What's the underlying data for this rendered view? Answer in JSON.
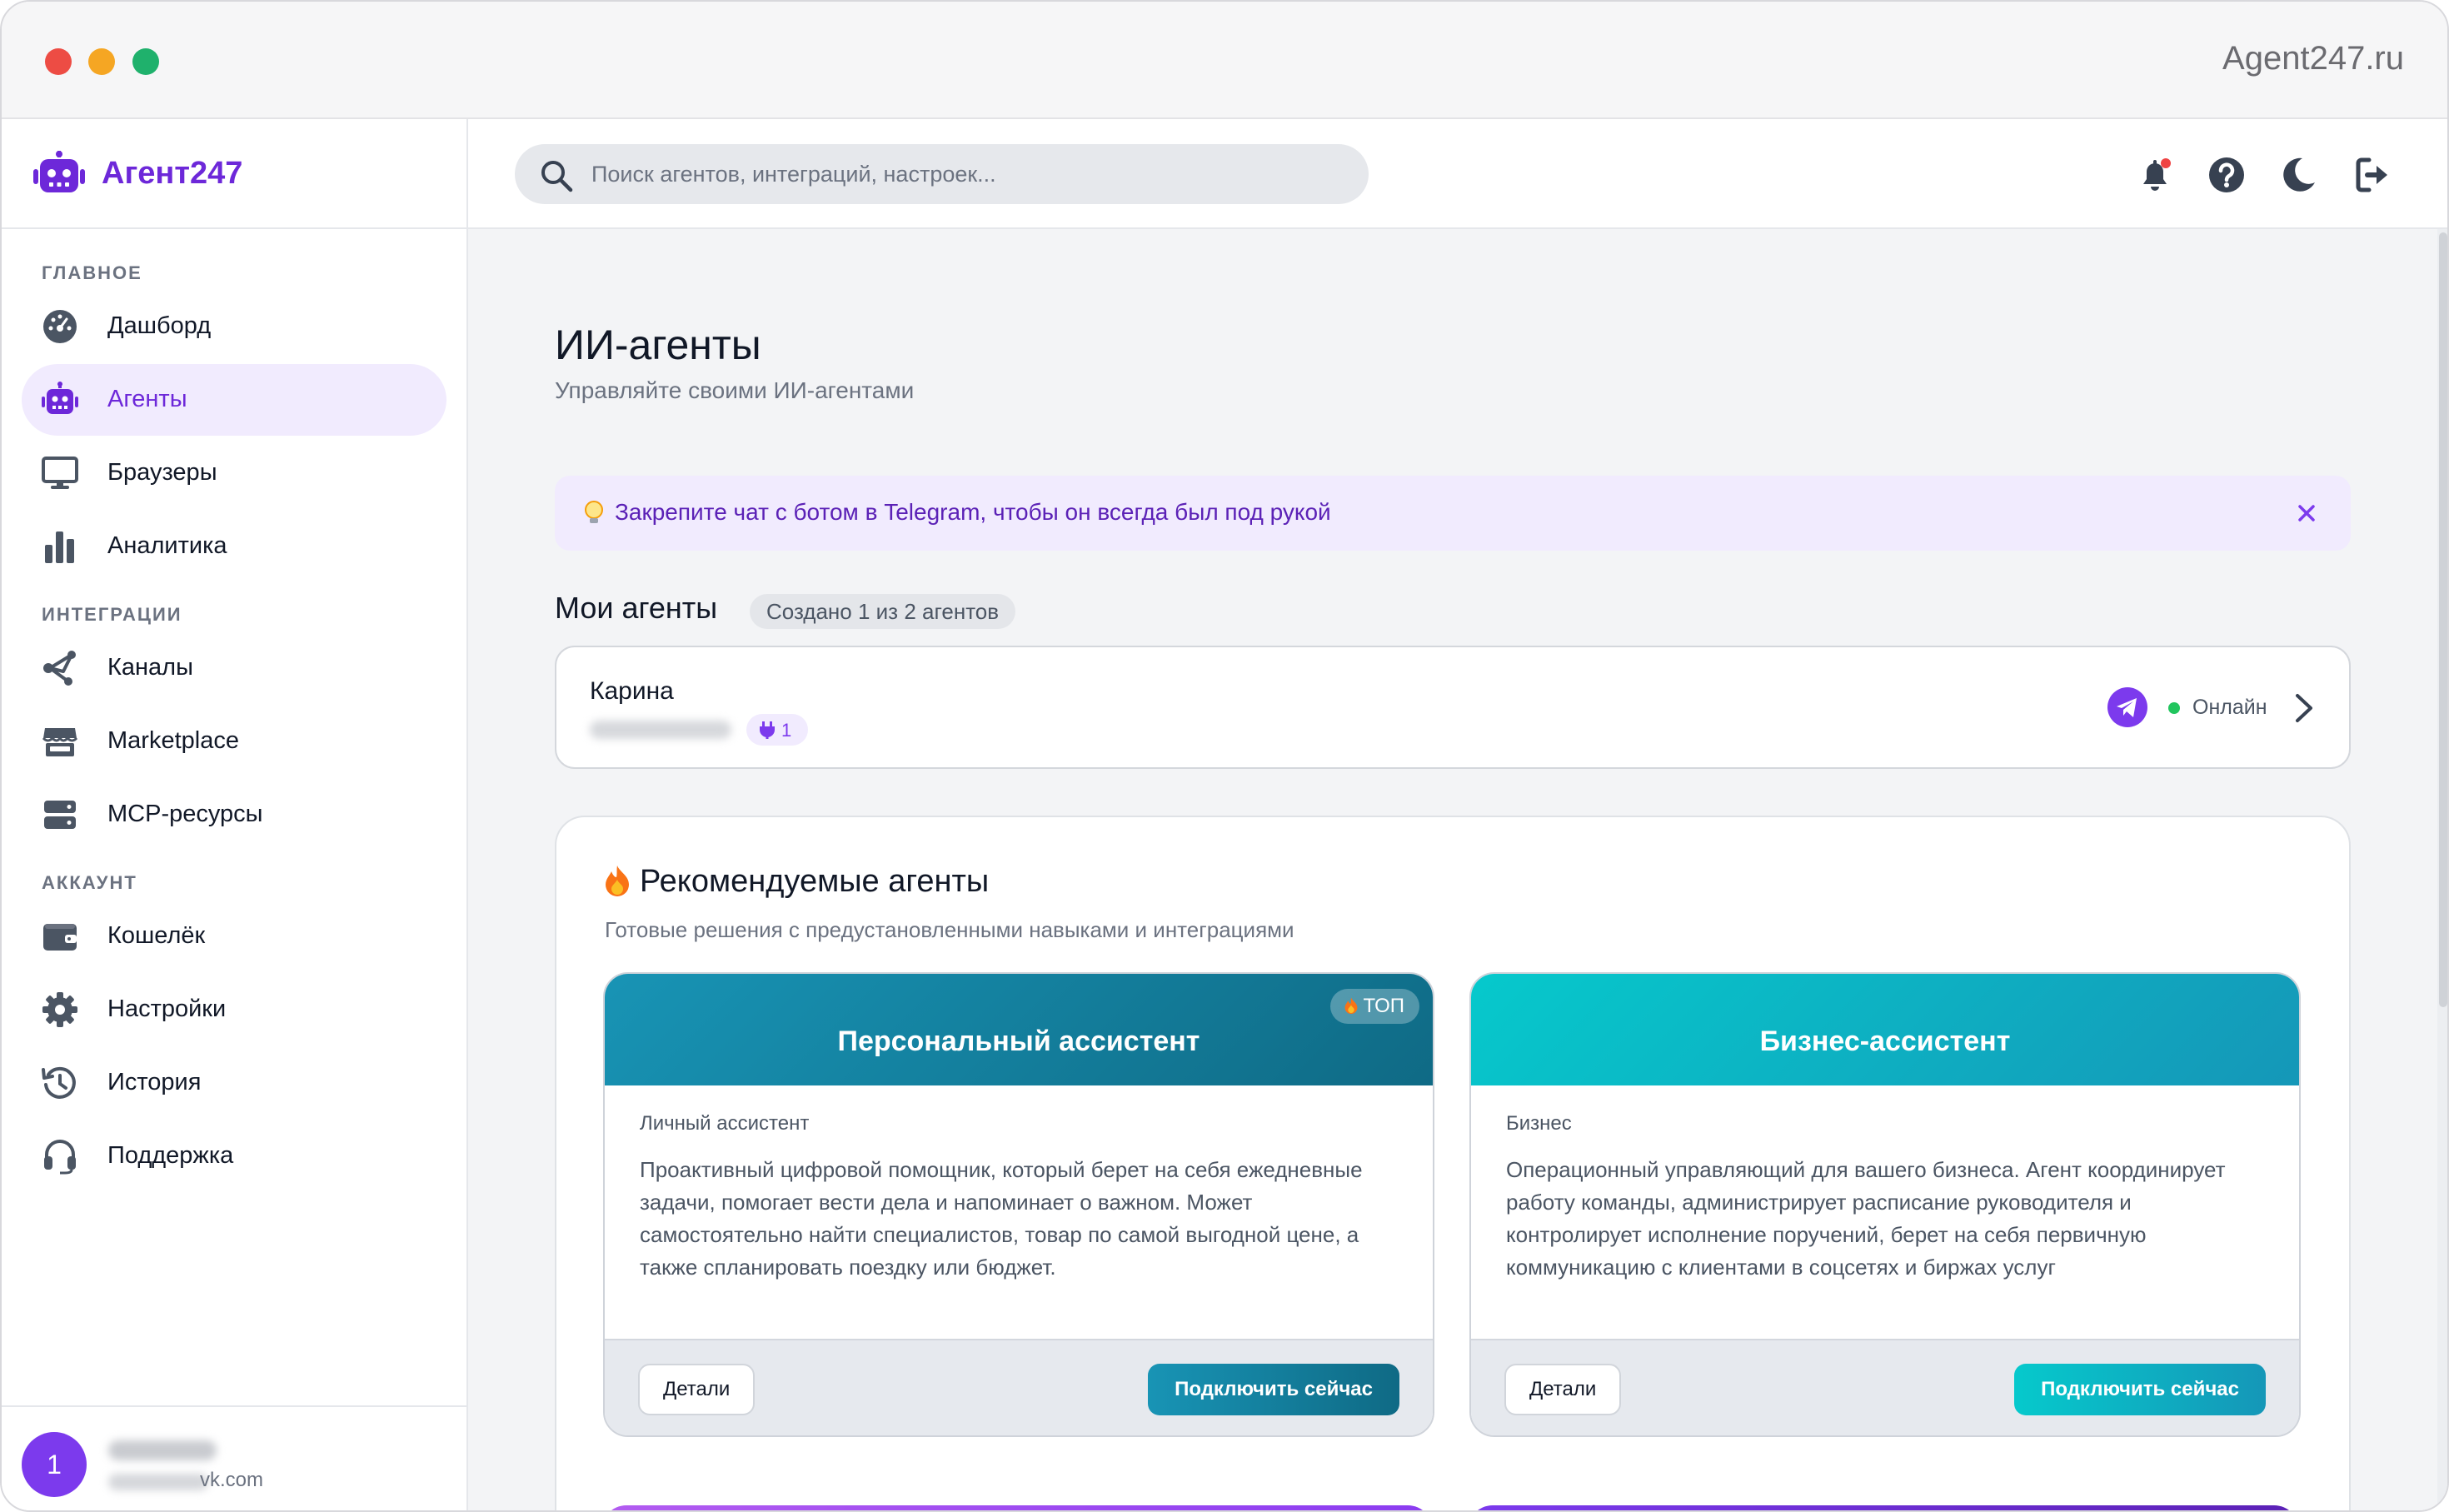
{
  "window": {
    "url": "Agent247.ru"
  },
  "brand": {
    "name": "Агент247"
  },
  "search": {
    "placeholder": "Поиск агентов, интеграций, настроек..."
  },
  "sidebar": {
    "sections": [
      {
        "title": "ГЛАВНОЕ",
        "items": [
          {
            "label": "Дашборд",
            "icon": "dashboard-gauge-icon"
          },
          {
            "label": "Агенты",
            "icon": "robot-icon",
            "active": true
          },
          {
            "label": "Браузеры",
            "icon": "monitor-icon"
          },
          {
            "label": "Аналитика",
            "icon": "bar-chart-icon"
          }
        ]
      },
      {
        "title": "ИНТЕГРАЦИИ",
        "items": [
          {
            "label": "Каналы",
            "icon": "share-nodes-icon"
          },
          {
            "label": "Marketplace",
            "icon": "store-icon"
          },
          {
            "label": "MCP-ресурсы",
            "icon": "server-icon"
          }
        ]
      },
      {
        "title": "АККАУНТ",
        "items": [
          {
            "label": "Кошелёк",
            "icon": "wallet-icon"
          },
          {
            "label": "Настройки",
            "icon": "gear-icon"
          },
          {
            "label": "История",
            "icon": "history-icon"
          },
          {
            "label": "Поддержка",
            "icon": "headset-icon"
          }
        ]
      }
    ]
  },
  "user": {
    "avatar_initial": "1",
    "email_suffix": "vk.com"
  },
  "header_icons": [
    "bell-icon",
    "help-icon",
    "moon-icon",
    "logout-icon"
  ],
  "page": {
    "title": "ИИ-агенты",
    "subtitle": "Управляйте своими ИИ-агентами"
  },
  "banner": {
    "text": "Закрепите чат с ботом в Telegram, чтобы он всегда был под рукой",
    "close": "×"
  },
  "my_agents": {
    "title": "Мои агенты",
    "count_label": "Создано 1 из 2 агентов",
    "items": [
      {
        "name": "Карина",
        "plugins": "1",
        "status": "Онлайн",
        "channel": "telegram"
      }
    ]
  },
  "recommended": {
    "title": "Рекомендуемые агенты",
    "subtitle": "Готовые решения с предустановленными навыками и интеграциями",
    "cards": [
      {
        "title": "Персональный ассистент",
        "badge": "ТОП",
        "category": "Личный ассистент",
        "description": "Проактивный цифровой помощник, который берет на себя ежедневные задачи, помогает вести дела и напоминает о важном. Может самостоятельно найти специалистов, товар по самой выгодной цене, а также спланировать поездку или бюджет.",
        "details_label": "Детали",
        "connect_label": "Подключить сейчас",
        "color_from": "#1894b5",
        "color_to": "#0f6a85"
      },
      {
        "title": "Бизнес-ассистент",
        "badge": "",
        "category": "Бизнес",
        "description": "Операционный управляющий для вашего бизнеса. Агент координирует работу команды, администрирует расписание руководителя и контролирует исполнение поручений, берет на себя первичную коммуникацию с клиентами в соцсетях и биржах услуг",
        "details_label": "Детали",
        "connect_label": "Подключить сейчас",
        "color_from": "#06c9cc",
        "color_to": "#1597b8"
      }
    ]
  },
  "colors": {
    "accent": "#6d28d9",
    "accent_light": "#f1ebfe",
    "online": "#22c55e",
    "telegram": "#7c3aed"
  }
}
